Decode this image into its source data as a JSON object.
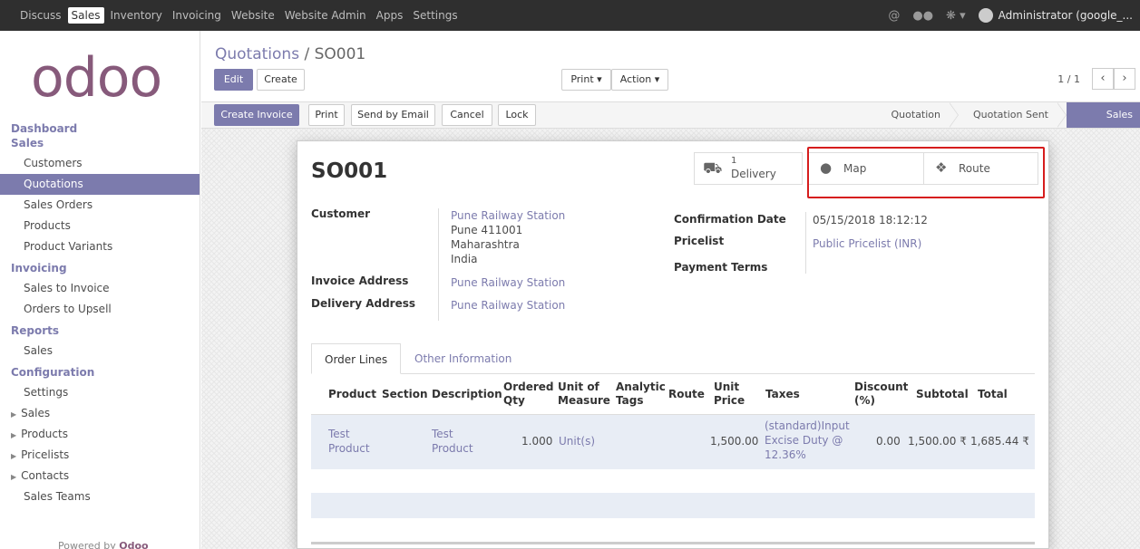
{
  "topbar": {
    "menu": [
      "Discuss",
      "Sales",
      "Inventory",
      "Invoicing",
      "Website",
      "Website Admin",
      "Apps",
      "Settings"
    ],
    "active_index": 1,
    "user": "Administrator (google_...",
    "icons": [
      "at-icon",
      "chat-icon",
      "bug-icon"
    ]
  },
  "sidebar": {
    "logo": "odoo",
    "dashboard": "Dashboard",
    "sections": [
      {
        "title": "Sales",
        "items": [
          "Customers",
          "Quotations",
          "Sales Orders",
          "Products",
          "Product Variants"
        ]
      },
      {
        "title": "Invoicing",
        "items": [
          "Sales to Invoice",
          "Orders to Upsell"
        ]
      },
      {
        "title": "Reports",
        "items": [
          "Sales"
        ]
      },
      {
        "title": "Configuration",
        "items": [
          "Settings"
        ]
      }
    ],
    "expandable": [
      "Sales",
      "Products",
      "Pricelists",
      "Contacts"
    ],
    "extra": "Sales Teams",
    "active_item": "Quotations",
    "powered_prefix": "Powered by",
    "powered_brand": "Odoo"
  },
  "control": {
    "breadcrumb_parent": "Quotations",
    "breadcrumb_sep": " / ",
    "breadcrumb_current": "SO001",
    "edit": "Edit",
    "create": "Create",
    "print": "Print",
    "action": "Action",
    "pager": "1 / 1"
  },
  "actions": [
    "Create Invoice",
    "Print",
    "Send by Email",
    "Cancel",
    "Lock"
  ],
  "statuses": [
    "Quotation",
    "Quotation Sent",
    "Sales Order"
  ],
  "active_status": "Sales Order",
  "sheet": {
    "name": "SO001",
    "smart_buttons": {
      "delivery_count": "1",
      "delivery_label": "Delivery",
      "map": "Map",
      "route": "Route"
    },
    "fields": {
      "customer_label": "Customer",
      "customer_name": "Pune Railway Station",
      "customer_lines": [
        "Pune 411001",
        "Maharashtra",
        "India"
      ],
      "invoice_label": "Invoice Address",
      "invoice_value": "Pune Railway Station",
      "delivery_label": "Delivery Address",
      "delivery_value": "Pune Railway Station",
      "confirm_label": "Confirmation Date",
      "confirm_value": "05/15/2018 18:12:12",
      "pricelist_label": "Pricelist",
      "pricelist_value": "Public Pricelist (INR)",
      "payment_label": "Payment Terms"
    },
    "tabs": [
      "Order Lines",
      "Other Information"
    ],
    "table": {
      "headers": [
        "Product",
        "Section",
        "Description",
        "Ordered Qty",
        "Unit of Measure",
        "Analytic Tags",
        "Route",
        "Unit Price",
        "Taxes",
        "Discount (%)",
        "Subtotal",
        "Total"
      ],
      "rows": [
        {
          "product": "Test Product",
          "section": "",
          "description": "Test Product",
          "qty": "1.000",
          "uom": "Unit(s)",
          "tags": "",
          "route": "",
          "price": "1,500.00",
          "taxes": "(standard)Input Excise Duty @ 12.36%",
          "discount": "0.00",
          "subtotal": "1,500.00 ₹",
          "total": "1,685.44 ₹"
        }
      ]
    }
  },
  "colors": {
    "accent": "#7c7bad",
    "brand": "#875a7b",
    "highlight": "#d61d1d",
    "topbar": "#2f2f2f"
  }
}
